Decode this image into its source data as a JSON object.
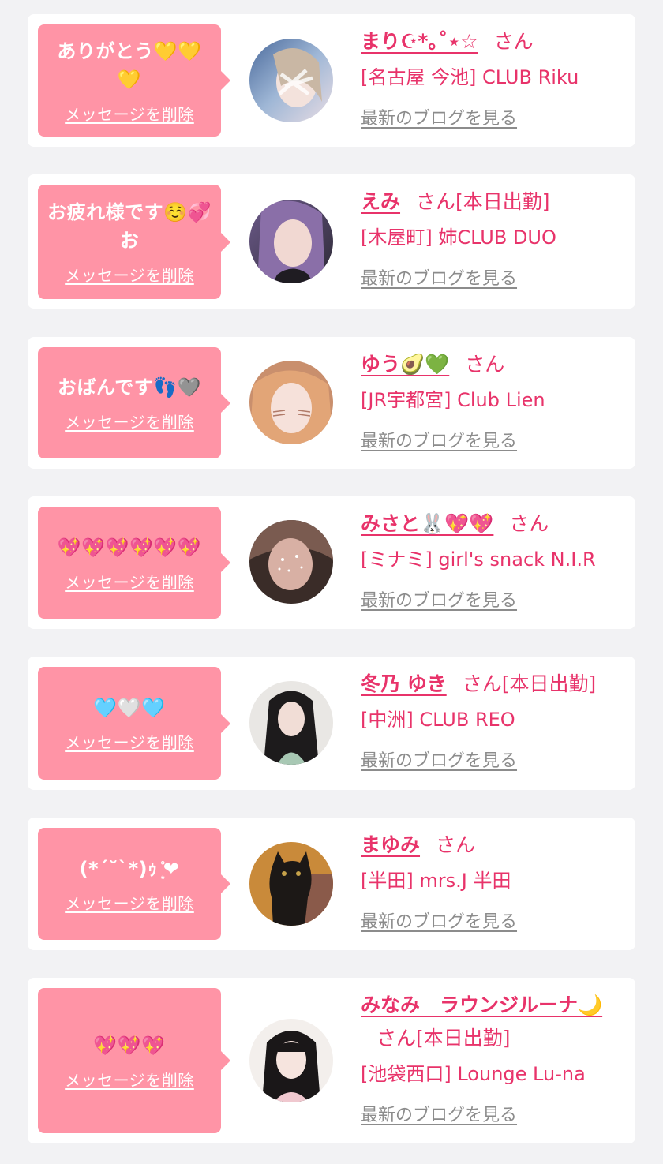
{
  "delete_label": "メッセージを削除",
  "blog_label": "最新のブログを見る",
  "san_label": "さん",
  "colors": {
    "page_bg": "#f2f2f4",
    "card_bg": "#ffffff",
    "bubble_bg": "#ff94a6",
    "name_color": "#e8336a",
    "link_gray": "#8c8c8c"
  },
  "items": [
    {
      "message": "ありがとう💛💛💛",
      "name": "まり☪︎*｡˚⋆☆",
      "status": "",
      "shop": "[名古屋 今池] CLUB Riku",
      "avatar_icon": "photo-avatar-icon"
    },
    {
      "message": "お疲れ様です☺️💞お",
      "name": "えみ",
      "status": "[本日出勤]",
      "shop": "[木屋町] 姉CLUB DUO",
      "avatar_icon": "photo-avatar-icon"
    },
    {
      "message": "おばんです👣🩶",
      "name": "ゆう🥑💚",
      "status": "",
      "shop": "[JR宇都宮] Club Lien",
      "avatar_icon": "photo-avatar-icon"
    },
    {
      "message": "💖💖💖💖💖💖",
      "name": "みさと🐰💖💖",
      "status": "",
      "shop": "[ミナミ] girl's snack N.I.R",
      "avatar_icon": "photo-avatar-icon"
    },
    {
      "message": "🩵🤍🩵",
      "name": "冬乃 ゆき",
      "status": "[本日出勤]",
      "shop": "[中洲] CLUB REO",
      "avatar_icon": "photo-avatar-icon"
    },
    {
      "message": "(*´˘`*)ｩ ͙̊❤",
      "name": "まゆみ",
      "status": "",
      "shop": "[半田] mrs.J 半田",
      "avatar_icon": "cat-photo-avatar-icon"
    },
    {
      "message": "💖💖💖",
      "name": "みなみ　ラウンジルーナ🌙",
      "status": "[本日出勤]",
      "shop": "[池袋西口] Lounge Lu-na",
      "avatar_icon": "photo-avatar-icon"
    }
  ]
}
